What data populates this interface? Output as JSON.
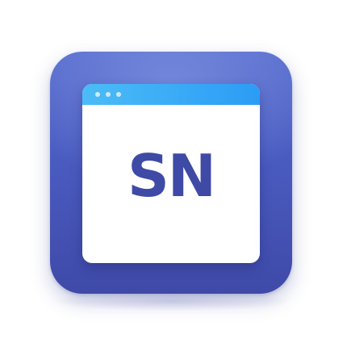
{
  "app_icon": {
    "monogram": "SN",
    "colors": {
      "background_top": "#5a6fd0",
      "background_bottom": "#3f4aa8",
      "titlebar_left": "#4cbcf7",
      "titlebar_right": "#2b9cf5",
      "window": "#ffffff",
      "monogram": "#3e4aa6"
    },
    "window_icon": "browser-window-icon"
  }
}
